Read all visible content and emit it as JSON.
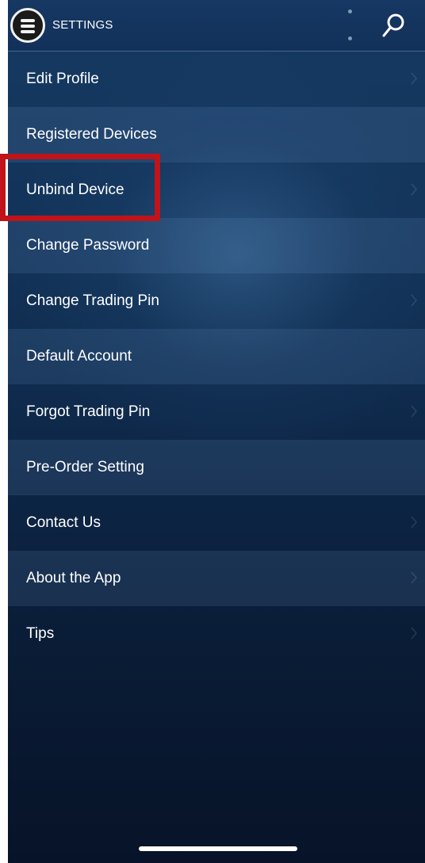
{
  "header": {
    "title": "SETTINGS",
    "menu_icon": "hamburger-menu-icon",
    "overflow_icon": "vertical-dots-icon",
    "search_icon": "search-icon"
  },
  "menu": {
    "items": [
      {
        "label": "Edit Profile"
      },
      {
        "label": "Registered Devices"
      },
      {
        "label": "Unbind Device"
      },
      {
        "label": "Change Password"
      },
      {
        "label": "Change Trading Pin"
      },
      {
        "label": "Default Account"
      },
      {
        "label": "Forgot Trading Pin"
      },
      {
        "label": "Pre-Order Setting"
      },
      {
        "label": "Contact Us"
      },
      {
        "label": "About the App"
      },
      {
        "label": "Tips"
      }
    ],
    "highlighted_item": "Unbind Device"
  },
  "colors": {
    "highlight_box": "#c0141a",
    "background_top": "#163a63",
    "background_bottom": "#071328",
    "text": "#ffffff"
  }
}
